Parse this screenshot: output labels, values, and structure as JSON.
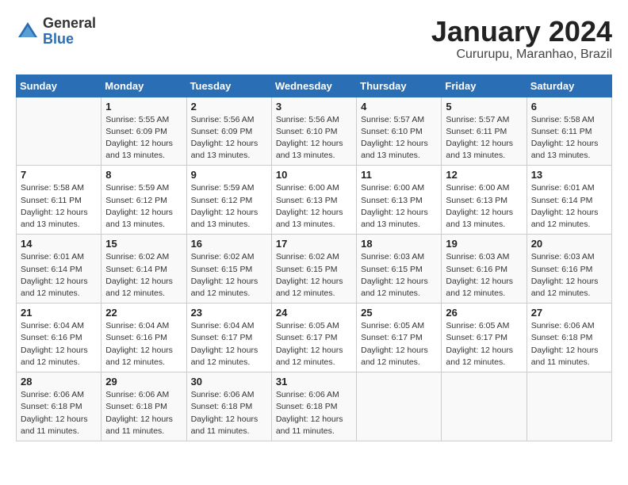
{
  "header": {
    "logo_general": "General",
    "logo_blue": "Blue",
    "month_title": "January 2024",
    "location": "Cururupu, Maranhao, Brazil"
  },
  "days_of_week": [
    "Sunday",
    "Monday",
    "Tuesday",
    "Wednesday",
    "Thursday",
    "Friday",
    "Saturday"
  ],
  "weeks": [
    [
      {
        "day": "",
        "info": ""
      },
      {
        "day": "1",
        "info": "Sunrise: 5:55 AM\nSunset: 6:09 PM\nDaylight: 12 hours\nand 13 minutes."
      },
      {
        "day": "2",
        "info": "Sunrise: 5:56 AM\nSunset: 6:09 PM\nDaylight: 12 hours\nand 13 minutes."
      },
      {
        "day": "3",
        "info": "Sunrise: 5:56 AM\nSunset: 6:10 PM\nDaylight: 12 hours\nand 13 minutes."
      },
      {
        "day": "4",
        "info": "Sunrise: 5:57 AM\nSunset: 6:10 PM\nDaylight: 12 hours\nand 13 minutes."
      },
      {
        "day": "5",
        "info": "Sunrise: 5:57 AM\nSunset: 6:11 PM\nDaylight: 12 hours\nand 13 minutes."
      },
      {
        "day": "6",
        "info": "Sunrise: 5:58 AM\nSunset: 6:11 PM\nDaylight: 12 hours\nand 13 minutes."
      }
    ],
    [
      {
        "day": "7",
        "info": "Sunrise: 5:58 AM\nSunset: 6:11 PM\nDaylight: 12 hours\nand 13 minutes."
      },
      {
        "day": "8",
        "info": "Sunrise: 5:59 AM\nSunset: 6:12 PM\nDaylight: 12 hours\nand 13 minutes."
      },
      {
        "day": "9",
        "info": "Sunrise: 5:59 AM\nSunset: 6:12 PM\nDaylight: 12 hours\nand 13 minutes."
      },
      {
        "day": "10",
        "info": "Sunrise: 6:00 AM\nSunset: 6:13 PM\nDaylight: 12 hours\nand 13 minutes."
      },
      {
        "day": "11",
        "info": "Sunrise: 6:00 AM\nSunset: 6:13 PM\nDaylight: 12 hours\nand 13 minutes."
      },
      {
        "day": "12",
        "info": "Sunrise: 6:00 AM\nSunset: 6:13 PM\nDaylight: 12 hours\nand 13 minutes."
      },
      {
        "day": "13",
        "info": "Sunrise: 6:01 AM\nSunset: 6:14 PM\nDaylight: 12 hours\nand 12 minutes."
      }
    ],
    [
      {
        "day": "14",
        "info": "Sunrise: 6:01 AM\nSunset: 6:14 PM\nDaylight: 12 hours\nand 12 minutes."
      },
      {
        "day": "15",
        "info": "Sunrise: 6:02 AM\nSunset: 6:14 PM\nDaylight: 12 hours\nand 12 minutes."
      },
      {
        "day": "16",
        "info": "Sunrise: 6:02 AM\nSunset: 6:15 PM\nDaylight: 12 hours\nand 12 minutes."
      },
      {
        "day": "17",
        "info": "Sunrise: 6:02 AM\nSunset: 6:15 PM\nDaylight: 12 hours\nand 12 minutes."
      },
      {
        "day": "18",
        "info": "Sunrise: 6:03 AM\nSunset: 6:15 PM\nDaylight: 12 hours\nand 12 minutes."
      },
      {
        "day": "19",
        "info": "Sunrise: 6:03 AM\nSunset: 6:16 PM\nDaylight: 12 hours\nand 12 minutes."
      },
      {
        "day": "20",
        "info": "Sunrise: 6:03 AM\nSunset: 6:16 PM\nDaylight: 12 hours\nand 12 minutes."
      }
    ],
    [
      {
        "day": "21",
        "info": "Sunrise: 6:04 AM\nSunset: 6:16 PM\nDaylight: 12 hours\nand 12 minutes."
      },
      {
        "day": "22",
        "info": "Sunrise: 6:04 AM\nSunset: 6:16 PM\nDaylight: 12 hours\nand 12 minutes."
      },
      {
        "day": "23",
        "info": "Sunrise: 6:04 AM\nSunset: 6:17 PM\nDaylight: 12 hours\nand 12 minutes."
      },
      {
        "day": "24",
        "info": "Sunrise: 6:05 AM\nSunset: 6:17 PM\nDaylight: 12 hours\nand 12 minutes."
      },
      {
        "day": "25",
        "info": "Sunrise: 6:05 AM\nSunset: 6:17 PM\nDaylight: 12 hours\nand 12 minutes."
      },
      {
        "day": "26",
        "info": "Sunrise: 6:05 AM\nSunset: 6:17 PM\nDaylight: 12 hours\nand 12 minutes."
      },
      {
        "day": "27",
        "info": "Sunrise: 6:06 AM\nSunset: 6:18 PM\nDaylight: 12 hours\nand 11 minutes."
      }
    ],
    [
      {
        "day": "28",
        "info": "Sunrise: 6:06 AM\nSunset: 6:18 PM\nDaylight: 12 hours\nand 11 minutes."
      },
      {
        "day": "29",
        "info": "Sunrise: 6:06 AM\nSunset: 6:18 PM\nDaylight: 12 hours\nand 11 minutes."
      },
      {
        "day": "30",
        "info": "Sunrise: 6:06 AM\nSunset: 6:18 PM\nDaylight: 12 hours\nand 11 minutes."
      },
      {
        "day": "31",
        "info": "Sunrise: 6:06 AM\nSunset: 6:18 PM\nDaylight: 12 hours\nand 11 minutes."
      },
      {
        "day": "",
        "info": ""
      },
      {
        "day": "",
        "info": ""
      },
      {
        "day": "",
        "info": ""
      }
    ]
  ]
}
